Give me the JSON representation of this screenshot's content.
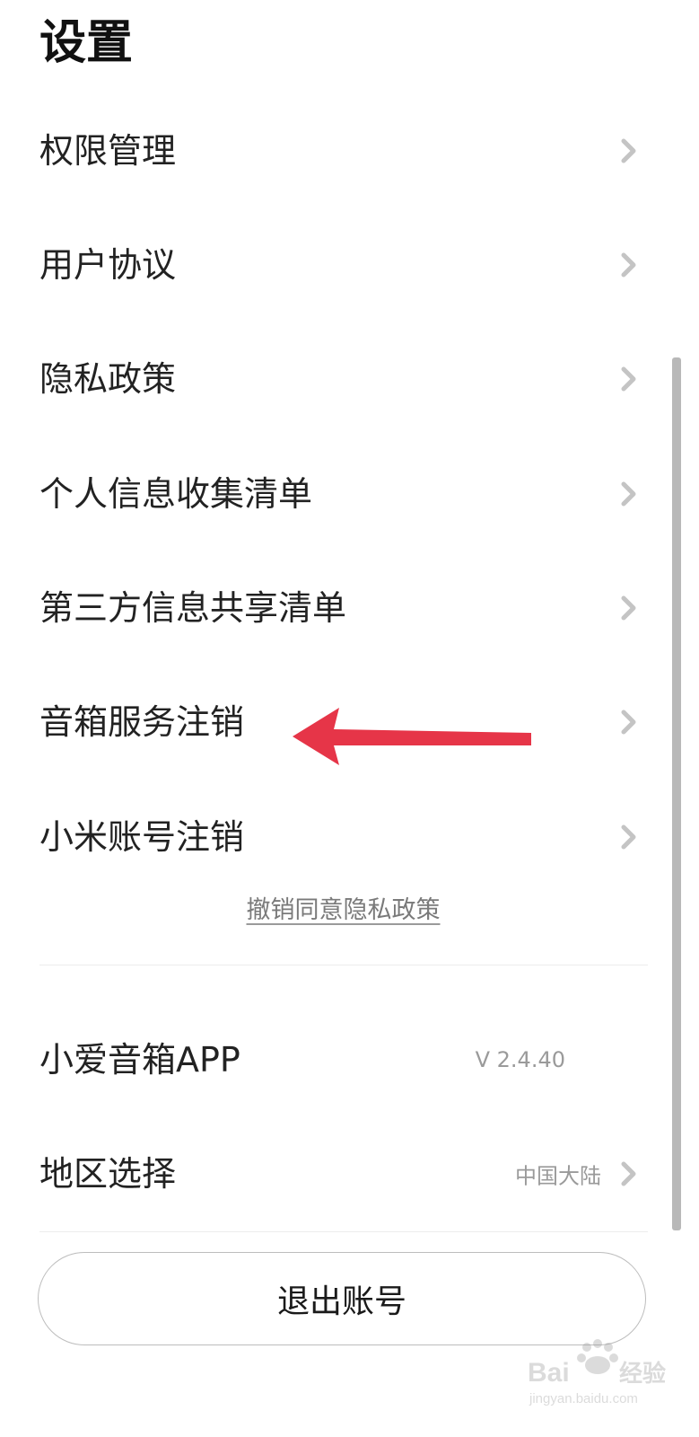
{
  "header": {
    "title": "设置"
  },
  "menu": {
    "permission_management": "权限管理",
    "user_agreement": "用户协议",
    "privacy_policy": "隐私政策",
    "personal_info_list": "个人信息收集清单",
    "third_party_info_list": "第三方信息共享清单",
    "speaker_service_cancel": "音箱服务注销",
    "xiaomi_account_cancel": "小米账号注销"
  },
  "revoke": {
    "label": "撤销同意隐私政策"
  },
  "app_info": {
    "label": "小爱音箱APP",
    "version": "V 2.4.40"
  },
  "region": {
    "label": "地区选择",
    "value": "中国大陆"
  },
  "logout": {
    "label": "退出账号"
  },
  "watermark": {
    "brand": "Bai",
    "brand_suffix": "经验",
    "url": "jingyan.baidu.com"
  },
  "colors": {
    "annotation_arrow": "#e63548",
    "chevron": "#c4c4c4",
    "scrollbar": "#b8b8b8"
  }
}
